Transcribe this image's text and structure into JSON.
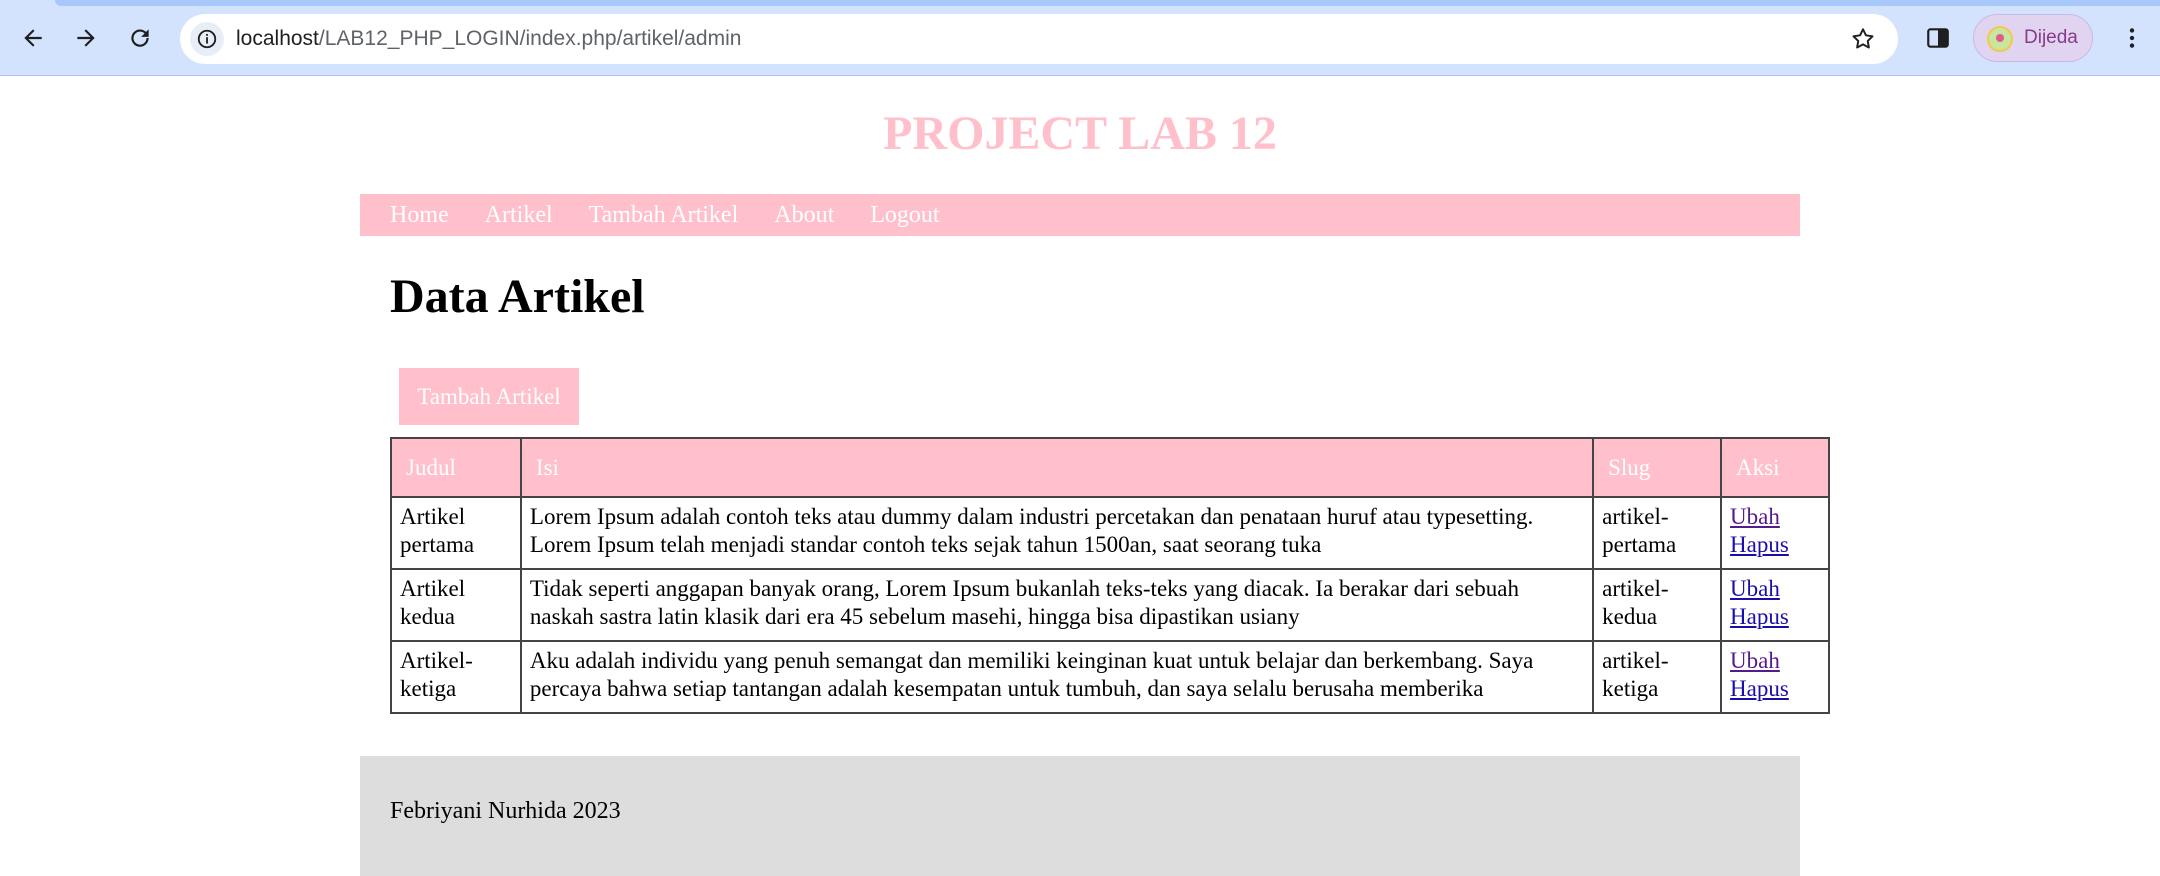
{
  "browser": {
    "url_host": "localhost",
    "url_path": "/LAB12_PHP_LOGIN/index.php/artikel/admin",
    "profile_label": "Dijeda"
  },
  "site": {
    "title": "PROJECT LAB 12",
    "nav": [
      "Home",
      "Artikel",
      "Tambah Artikel",
      "About",
      "Logout"
    ]
  },
  "main": {
    "heading": "Data Artikel",
    "add_button": "Tambah Artikel",
    "table": {
      "headers": [
        "Judul",
        "Isi",
        "Slug",
        "Aksi"
      ],
      "rows": [
        {
          "judul": "Artikel pertama",
          "isi": "Lorem Ipsum adalah contoh teks atau dummy dalam industri percetakan dan penataan huruf atau typesetting. Lorem Ipsum telah menjadi standar contoh teks sejak tahun 1500an, saat seorang tuka",
          "slug": "artikel-pertama",
          "ubah": "Ubah",
          "hapus": "Hapus"
        },
        {
          "judul": "Artikel kedua",
          "isi": "Tidak seperti anggapan banyak orang, Lorem Ipsum bukanlah teks-teks yang diacak. Ia berakar dari sebuah naskah sastra latin klasik dari era 45 sebelum masehi, hingga bisa dipastikan usiany",
          "slug": "artikel-kedua",
          "ubah": "Ubah",
          "hapus": "Hapus"
        },
        {
          "judul": "Artikel-ketiga",
          "isi": "Aku adalah individu yang penuh semangat dan memiliki keinginan kuat untuk belajar dan berkembang. Saya percaya bahwa setiap tantangan adalah kesempatan untuk tumbuh, dan saya selalu berusaha memberika",
          "slug": "artikel-ketiga",
          "ubah": "Ubah",
          "hapus": "Hapus"
        }
      ]
    }
  },
  "footer": {
    "credit": "Febriyani Nurhida 2023"
  },
  "colors": {
    "accent": "#ffc0cb",
    "footer_bg": "#dddddd",
    "chrome_bg": "#d3e3fd"
  }
}
